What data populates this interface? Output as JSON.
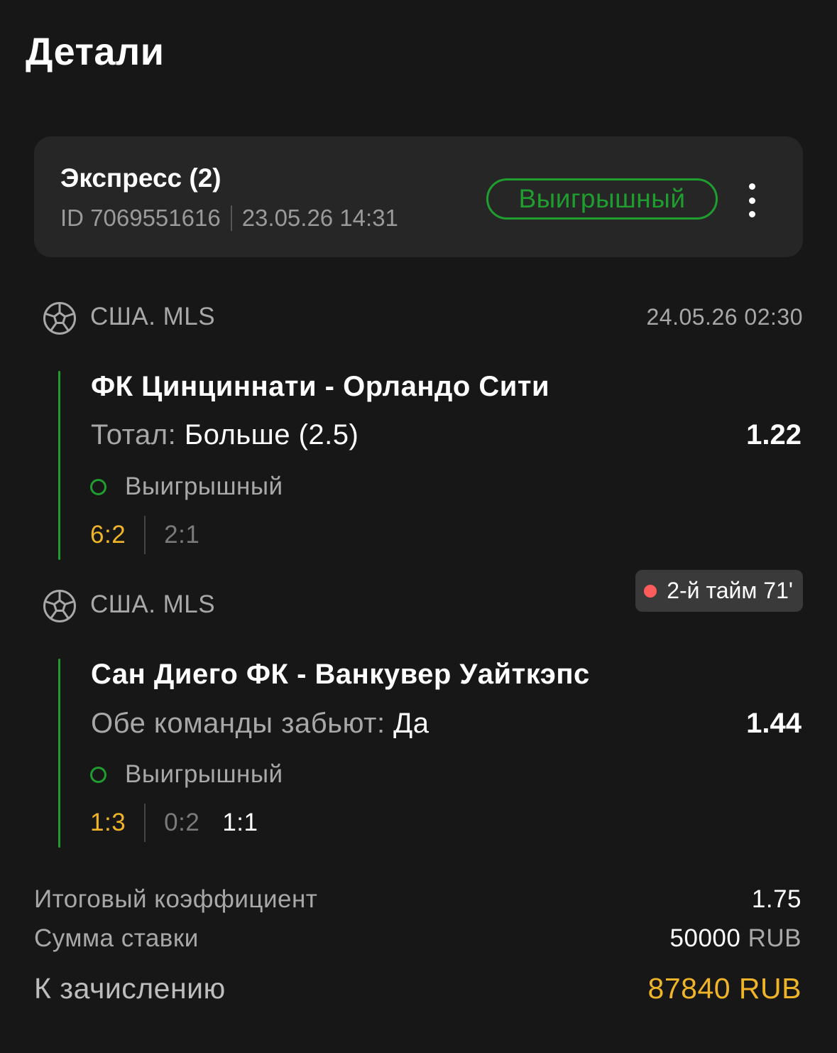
{
  "page": {
    "title": "Детали"
  },
  "bet": {
    "title": "Экспресс (2)",
    "id": "ID 7069551616",
    "datetime": "23.05.26 14:31",
    "status": "Выигрышный"
  },
  "events": [
    {
      "league": "США. MLS",
      "time": "24.05.26 02:30",
      "match": "ФК Цинциннати - Орландо Сити",
      "market_label": "Тотал: ",
      "market_pick": "Больше (2.5)",
      "odds": "1.22",
      "status": "Выигрышный",
      "score_main": "6:2",
      "score_half": "2:1"
    },
    {
      "league": "США. MLS",
      "live": "2-й тайм 71'",
      "match": "Сан Диего ФК - Ванкувер Уайткэпс",
      "market_label": "Обе команды забьют: ",
      "market_pick": "Да",
      "odds": "1.44",
      "status": "Выигрышный",
      "score_main": "1:3",
      "score_half": "0:2",
      "score_current": "1:1"
    }
  ],
  "summary": {
    "total_odds_label": "Итоговый коэффициент",
    "total_odds": "1.75",
    "stake_label": "Сумма ставки",
    "stake_amount": "50000",
    "stake_currency": "RUB",
    "payout_label": "К зачислению",
    "payout": "87840 RUB"
  },
  "colors": {
    "background": "#171717",
    "card": "#262626",
    "win_green": "#1f9d2f",
    "accent_yellow": "#f0b429",
    "live_red": "#ff5c5c"
  },
  "icons": [
    "soccer-ball-icon",
    "more-vertical-icon",
    "live-dot-icon",
    "win-ring-icon"
  ]
}
